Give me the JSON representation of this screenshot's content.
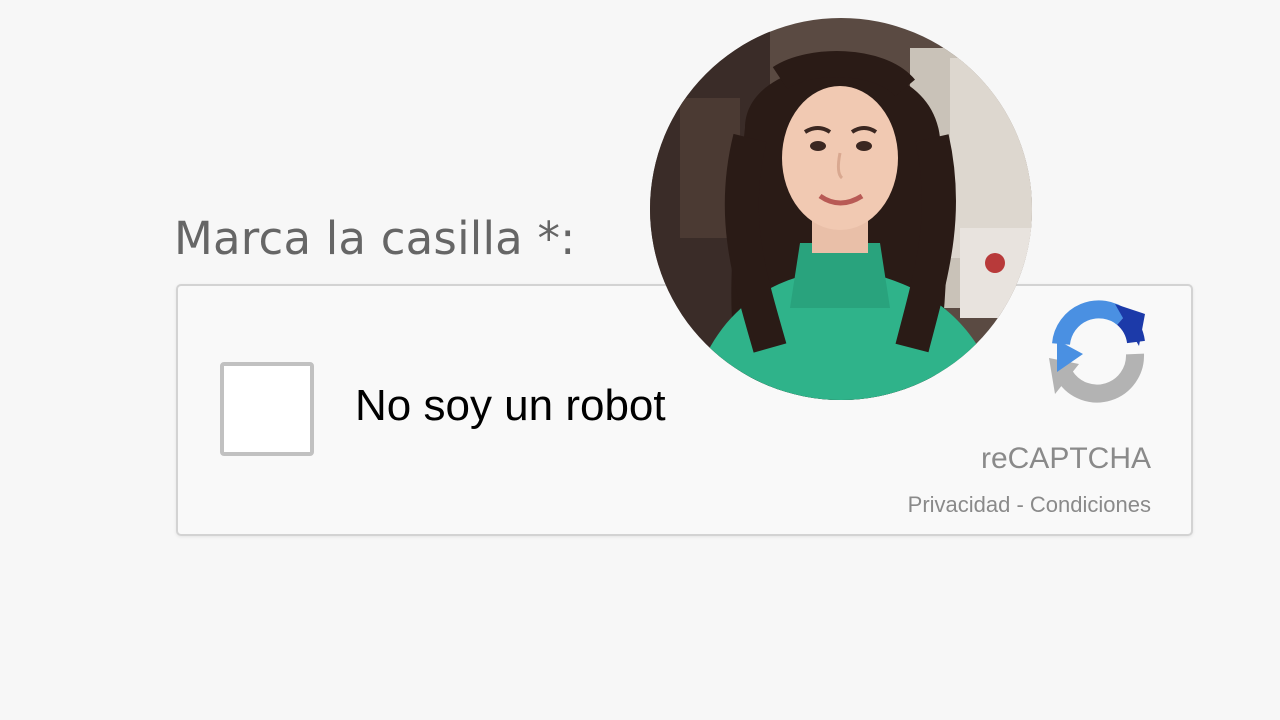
{
  "form": {
    "field_label": "Marca la casilla *:"
  },
  "captcha": {
    "checkbox_checked": false,
    "checkbox_label": "No soy un robot",
    "brand": "reCAPTCHA",
    "privacy_link": "Privacidad",
    "separator": " - ",
    "terms_link": "Condiciones",
    "logo_icon": "recaptcha-logo",
    "colors": {
      "logo_blue": "#4a90e2",
      "logo_dark_blue": "#1c3aa9",
      "logo_gray": "#b3b3b3",
      "text_gray": "#8a8a8a",
      "border": "#d3d3d3"
    }
  },
  "overlay": {
    "avatar": "portrait-photo",
    "sweater_color": "#2fb38a"
  }
}
